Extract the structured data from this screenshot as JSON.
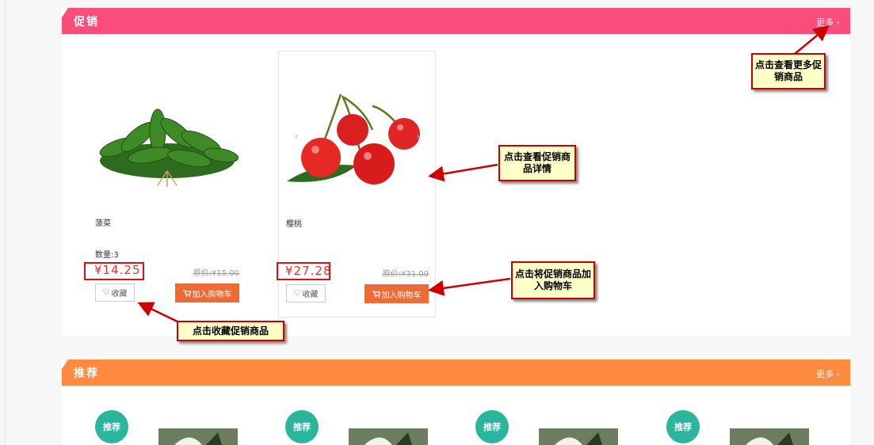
{
  "promo": {
    "title": "促销",
    "more": "更多 ›",
    "products": [
      {
        "name": "菠菜",
        "qty": "数量:3",
        "price": "¥14.25",
        "orig": "原价:¥15.00",
        "fav": "收藏",
        "cart": "加入购物车",
        "image": "spinach"
      },
      {
        "name": "樱桃",
        "qty": "",
        "price": "¥27.28",
        "orig": "原价:¥31.00",
        "fav": "收藏",
        "cart": "加入购物车",
        "image": "cherries"
      }
    ]
  },
  "recommend": {
    "title": "推荐",
    "more": "更多 ›",
    "badge": "推荐"
  },
  "callouts": {
    "more": "点击查看更多促销商品",
    "detail": "点击查看促销商品详情",
    "cart": "点击将促销商品加入购物车",
    "fav": "点击收藏促销商品"
  },
  "icons": {
    "fav": "heart-icon",
    "cart": "cart-icon"
  },
  "colors": {
    "promo_header": "#fb4d7b",
    "recommend_header": "#fe8a3f",
    "cart_button": "#ef6b36",
    "price": "#e3322c",
    "badge": "#2bb59c"
  }
}
